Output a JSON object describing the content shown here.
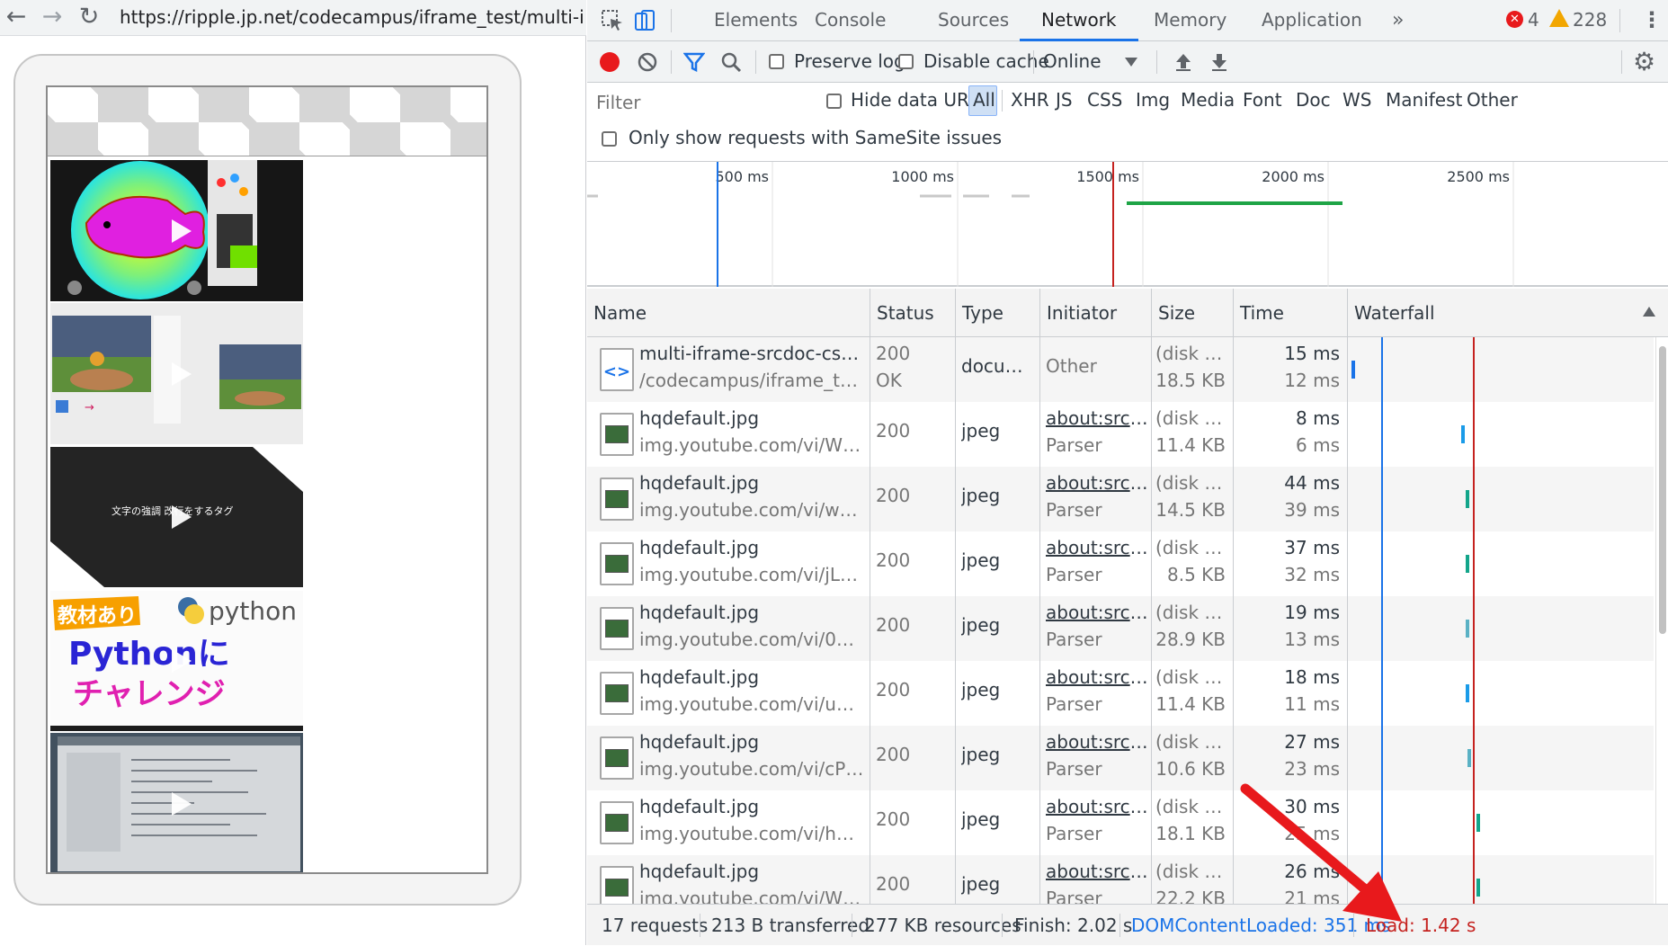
{
  "browser": {
    "url": "https://ripple.jp.net/codecampus/iframe_test/multi-i"
  },
  "page": {
    "thumbnails": [
      {
        "name": "thumb-paint-app",
        "overlay_text": ""
      },
      {
        "name": "thumb-baseball",
        "overlay_text": ""
      },
      {
        "name": "thumb-html-tags",
        "overlay_text": "文字の強調 改行をするタグ"
      },
      {
        "name": "thumb-python",
        "overlay_text_badge": "教材あり",
        "overlay_text_logo": "python",
        "overlay_text_main1": "Pythonに",
        "overlay_text_main2": "チャレンジ"
      },
      {
        "name": "thumb-code-screen",
        "overlay_text": ""
      }
    ]
  },
  "devtools": {
    "tabs": [
      "Elements",
      "Console",
      "Sources",
      "Network",
      "Memory",
      "Application"
    ],
    "active_tab": "Network",
    "more_tabs": "»",
    "errors_count": "4",
    "warnings_count": "228",
    "toolbar": {
      "preserve_log": "Preserve log",
      "disable_cache": "Disable cache",
      "throttling": "Online"
    },
    "filter": {
      "placeholder": "Filter",
      "hide_data_urls": "Hide data URLs",
      "types": [
        "All",
        "XHR",
        "JS",
        "CSS",
        "Img",
        "Media",
        "Font",
        "Doc",
        "WS",
        "Manifest",
        "Other"
      ],
      "active_type": "All",
      "samesite": "Only show requests with SameSite issues"
    },
    "overview": {
      "ticks": [
        "500 ms",
        "1000 ms",
        "1500 ms",
        "2000 ms",
        "2500 ms"
      ],
      "dom_content_loaded_ms": 351,
      "load_ms": 1420,
      "range_ms": 2550
    },
    "columns": [
      "Name",
      "Status",
      "Type",
      "Initiator",
      "Size",
      "Time",
      "Waterfall"
    ],
    "requests": [
      {
        "name": "multi-iframe-srcdoc-csstrick....",
        "path": "/codecampus/iframe_test",
        "status": "200",
        "status_text": "OK",
        "type": "docum...",
        "initiator": "Other",
        "initiator_sub": "",
        "size_top": "(disk ca...",
        "size": "18.5 KB",
        "time": "15 ms",
        "latency": "12 ms",
        "icon": "document-icon",
        "wf_start": 0.012,
        "wf_color": "#1a73e8"
      },
      {
        "name": "hqdefault.jpg",
        "path": "img.youtube.com/vi/WgFTP...",
        "status": "200",
        "status_text": "",
        "type": "jpeg",
        "initiator": "about:srcd...",
        "initiator_sub": "Parser",
        "size_top": "(disk ca...",
        "size": "11.4 KB",
        "time": "8 ms",
        "latency": "6 ms",
        "icon": "image-icon",
        "wf_start": 0.37,
        "wf_color": "#1a9be8"
      },
      {
        "name": "hqdefault.jpg",
        "path": "img.youtube.com/vi/wC17ns...",
        "status": "200",
        "status_text": "",
        "type": "jpeg",
        "initiator": "about:srcd...",
        "initiator_sub": "Parser",
        "size_top": "(disk ca...",
        "size": "14.5 KB",
        "time": "44 ms",
        "latency": "39 ms",
        "icon": "image-icon",
        "wf_start": 0.385,
        "wf_color": "#13a58a"
      },
      {
        "name": "hqdefault.jpg",
        "path": "img.youtube.com/vi/jL3cA99...",
        "status": "200",
        "status_text": "",
        "type": "jpeg",
        "initiator": "about:srcd...",
        "initiator_sub": "Parser",
        "size_top": "(disk ca...",
        "size": "8.5 KB",
        "time": "37 ms",
        "latency": "32 ms",
        "icon": "image-icon",
        "wf_start": 0.385,
        "wf_color": "#13a58a"
      },
      {
        "name": "hqdefault.jpg",
        "path": "img.youtube.com/vi/01Srj9Z...",
        "status": "200",
        "status_text": "",
        "type": "jpeg",
        "initiator": "about:srcd...",
        "initiator_sub": "Parser",
        "size_top": "(disk ca...",
        "size": "28.9 KB",
        "time": "19 ms",
        "latency": "13 ms",
        "icon": "image-icon",
        "wf_start": 0.385,
        "wf_color": "#5ab1c4"
      },
      {
        "name": "hqdefault.jpg",
        "path": "img.youtube.com/vi/u3FWi7...",
        "status": "200",
        "status_text": "",
        "type": "jpeg",
        "initiator": "about:srcd...",
        "initiator_sub": "Parser",
        "size_top": "(disk ca...",
        "size": "11.4 KB",
        "time": "18 ms",
        "latency": "11 ms",
        "icon": "image-icon",
        "wf_start": 0.385,
        "wf_color": "#1a9be8"
      },
      {
        "name": "hqdefault.jpg",
        "path": "img.youtube.com/vi/cPgZ_0...",
        "status": "200",
        "status_text": "",
        "type": "jpeg",
        "initiator": "about:srcd...",
        "initiator_sub": "Parser",
        "size_top": "(disk ca...",
        "size": "10.6 KB",
        "time": "27 ms",
        "latency": "23 ms",
        "icon": "image-icon",
        "wf_start": 0.39,
        "wf_color": "#5ab1c4"
      },
      {
        "name": "hqdefault.jpg",
        "path": "img.youtube.com/vi/hTPc8j1...",
        "status": "200",
        "status_text": "",
        "type": "jpeg",
        "initiator": "about:srcd...",
        "initiator_sub": "Parser",
        "size_top": "(disk ca...",
        "size": "18.1 KB",
        "time": "30 ms",
        "latency": "25 ms",
        "icon": "image-icon",
        "wf_start": 0.42,
        "wf_color": "#13a58a"
      },
      {
        "name": "hqdefault.jpg",
        "path": "img.youtube.com/vi/WJchct...",
        "status": "200",
        "status_text": "",
        "type": "jpeg",
        "initiator": "about:srcd...",
        "initiator_sub": "Parser",
        "size_top": "(disk ca...",
        "size": "22.2 KB",
        "time": "26 ms",
        "latency": "21 ms",
        "icon": "image-icon",
        "wf_start": 0.42,
        "wf_color": "#13a58a"
      }
    ],
    "summary": {
      "requests": "17 requests",
      "transferred": "213 B transferred",
      "resources": "277 KB resources",
      "finish": "Finish: 2.02 s",
      "dom_content_loaded": "DOMContentLoaded: 351 ms",
      "load": "Load: 1.42 s"
    },
    "colors": {
      "dcl": "#1a73e8",
      "load": "#c5221f",
      "annotation_arrow": "#e8191c",
      "record": "#e8191c"
    }
  }
}
